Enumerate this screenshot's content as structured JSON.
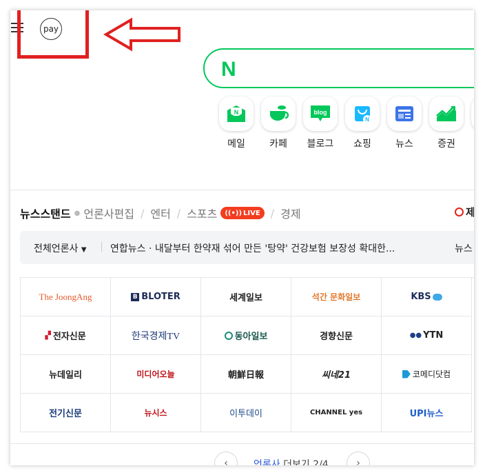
{
  "header": {
    "pay_label": "pay"
  },
  "search": {
    "logo": "N"
  },
  "shortcuts": [
    {
      "label": "메일",
      "icon": "mail-icon",
      "color": "#03c75a"
    },
    {
      "label": "카페",
      "icon": "cafe-icon",
      "color": "#03c75a"
    },
    {
      "label": "블로그",
      "icon": "blog-icon",
      "color": "#03c75a"
    },
    {
      "label": "쇼핑",
      "icon": "shopping-icon",
      "color": "#19b9ff"
    },
    {
      "label": "뉴스",
      "icon": "news-icon",
      "color": "#3d74e8"
    },
    {
      "label": "증권",
      "icon": "stock-icon",
      "color": "#03c75a"
    }
  ],
  "tabs": {
    "items": [
      "뉴스스탠드",
      "언론사편집",
      "엔터",
      "스포츠",
      "경제"
    ],
    "live_label": "LIVE",
    "right_label": "제"
  },
  "headline": {
    "all_label": "전체언론사",
    "text": "연합뉴스 · 내달부터 한약재 섞어 만든 '탕약' 건강보험 보장성 확대한...",
    "right_text": "뉴스"
  },
  "press": [
    [
      "The JoongAng",
      "BLOTER",
      "세계일보",
      "석간 문화일보",
      "KBS"
    ],
    [
      "전자신문",
      "한국경제TV",
      "동아일보",
      "경향신문",
      "YTN"
    ],
    [
      "뉴데일리",
      "미디어오늘",
      "朝鮮日報",
      "씨네21",
      "코메디닷컴"
    ],
    [
      "전기신문",
      "뉴시스",
      "이투데이",
      "CHANNEL yes",
      "UPI뉴스"
    ]
  ],
  "pager": {
    "link": "언론사",
    "text": " 더보기 2/4"
  },
  "colors": {
    "accent": "#03c75a",
    "red_annotation": "#e02020",
    "live": "#f43c1f"
  }
}
